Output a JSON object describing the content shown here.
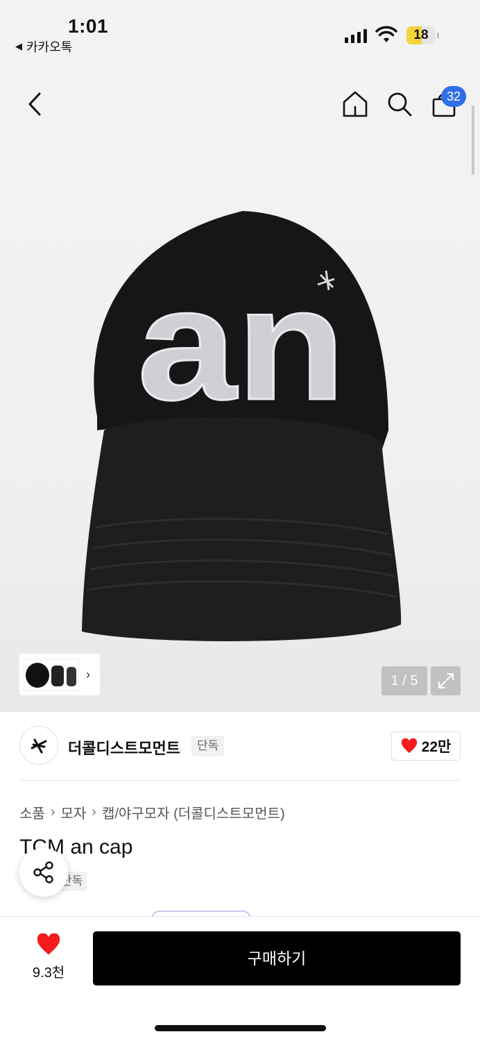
{
  "status_bar": {
    "time": "1:01",
    "back_app": "카카오톡",
    "battery": "18",
    "battery_level_percent": 18
  },
  "nav": {
    "cart_count": "32"
  },
  "gallery": {
    "page_indicator": "1 / 5",
    "thumb_chevron": "›"
  },
  "brand": {
    "name": "더콜디스트모먼트",
    "tag": "단독",
    "like_count": "22만"
  },
  "breadcrumb": [
    "소품",
    "모자",
    "캡/야구모자 (더콜디스트모먼트)"
  ],
  "breadcrumb_sep": "›",
  "product": {
    "title": "TCM an cap",
    "tag": "단독"
  },
  "bottom_bar": {
    "wish_count": "9.3천",
    "buy_label": "구매하기"
  },
  "colors": {
    "heart": "#f31b1b",
    "badge": "#2f6fe9",
    "battery": "#f5d33b"
  }
}
